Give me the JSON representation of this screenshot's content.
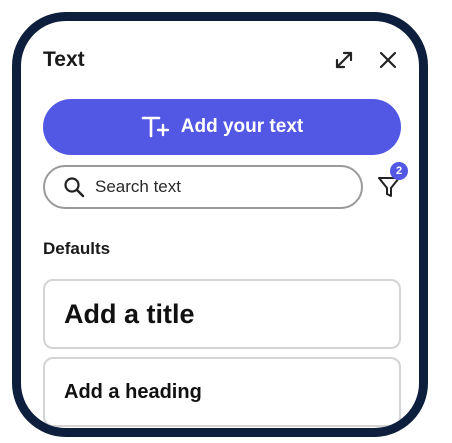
{
  "panel": {
    "title": "Text",
    "expand_icon": "expand-diagonal-icon",
    "close_icon": "close-icon"
  },
  "add_text_button": {
    "label": "Add your text",
    "icon": "text-add-icon",
    "color": "#5258e4"
  },
  "search": {
    "placeholder": "Search text",
    "value": "",
    "icon": "search-icon"
  },
  "filter": {
    "icon": "filter-icon",
    "badge_count": "2"
  },
  "defaults": {
    "label": "Defaults",
    "items": [
      {
        "label": "Add a title"
      },
      {
        "label": "Add a heading"
      }
    ]
  },
  "colors": {
    "frame": "#0d1f3d",
    "accent": "#5258e4"
  }
}
